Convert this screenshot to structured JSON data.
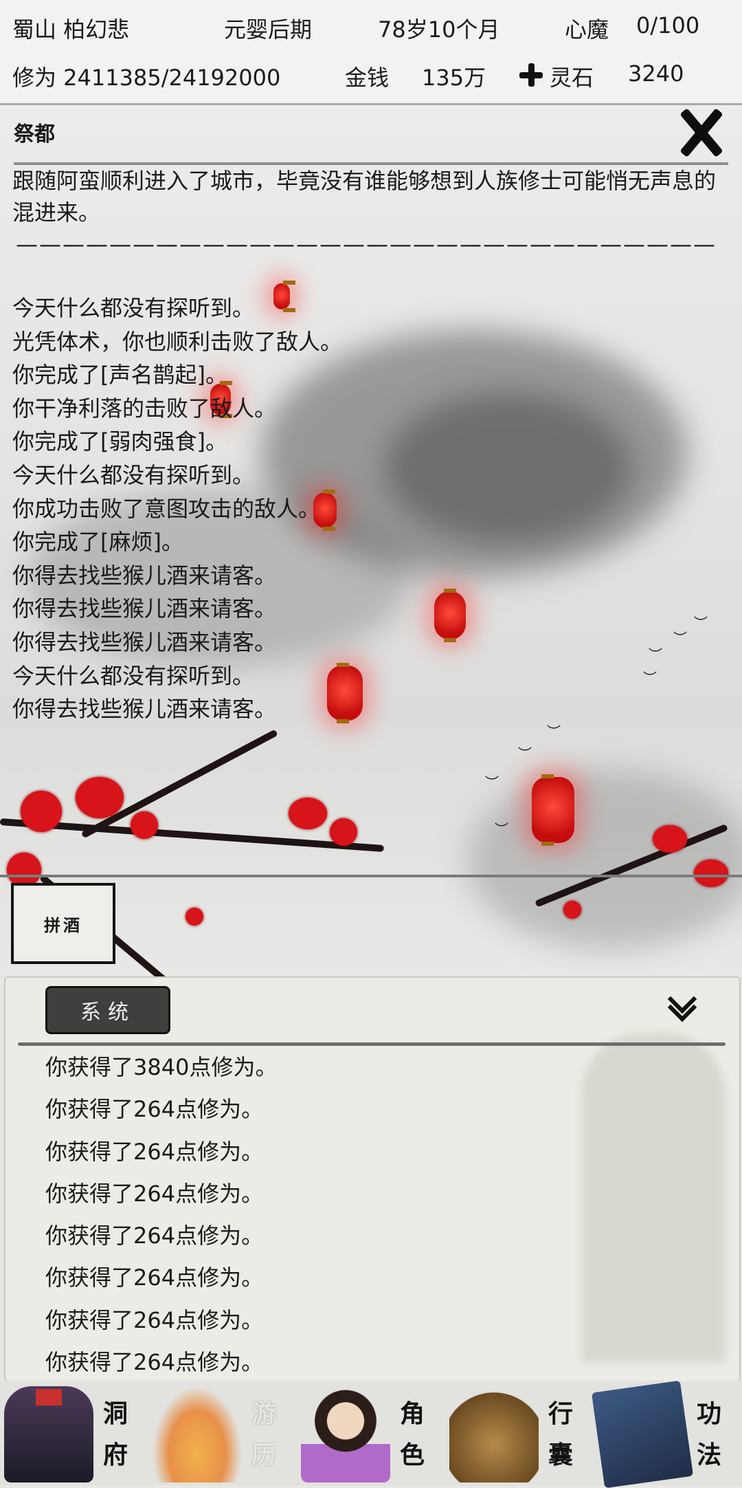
{
  "status": {
    "sect_name": "蜀山 柏幻悲",
    "realm": "元婴后期",
    "age": "78岁10个月",
    "heart_demon_label": "心魔",
    "heart_demon_value": "0/100",
    "cultivation_text": "修为 2411385/24192000",
    "money_label": "金钱",
    "money_value": "135万",
    "spirit_stone_label": "灵石",
    "spirit_stone_value": "3240",
    "spirit_stone_icon": "plus-icon"
  },
  "location": {
    "title": "祭都",
    "close_icon": "close-icon",
    "intro": "跟随阿蛮顺利进入了城市，毕竟没有谁能够想到人族修士可能悄无声息的混进来。",
    "divider": "——————————————————————————————",
    "log": [
      "今天什么都没有探听到。",
      "光凭体术，你也顺利击败了敌人。",
      "你完成了[声名鹊起]。",
      "你干净利落的击败了敌人。",
      "你完成了[弱肉强食]。",
      "今天什么都没有探听到。",
      "你成功击败了意图攻击的敌人。",
      "你完成了[麻烦]。",
      "你得去找些猴儿酒来请客。",
      "你得去找些猴儿酒来请客。",
      "你得去找些猴儿酒来请客。",
      "今天什么都没有探听到。",
      "你得去找些猴儿酒来请客。"
    ],
    "action_button": "拼酒"
  },
  "system": {
    "tab_label": "系统",
    "collapse_icon": "chevron-double-down-icon",
    "log": [
      "你获得了3840点修为。",
      "你获得了264点修为。",
      "你获得了264点修为。",
      "你获得了264点修为。",
      "你获得了264点修为。",
      "你获得了264点修为。",
      "你获得了264点修为。",
      "你获得了264点修为。"
    ]
  },
  "nav": [
    {
      "label": "洞府",
      "icon": "cave-house-icon",
      "active": false
    },
    {
      "label": "游历",
      "icon": "travel-icon",
      "active": true
    },
    {
      "label": "角色",
      "icon": "character-icon",
      "active": false
    },
    {
      "label": "行囊",
      "icon": "bag-icon",
      "active": false
    },
    {
      "label": "功法",
      "icon": "book-icon",
      "active": false
    }
  ],
  "colors": {
    "lantern": "#d6141a",
    "ink": "#1a1a1a",
    "panel": "#ecece6"
  }
}
